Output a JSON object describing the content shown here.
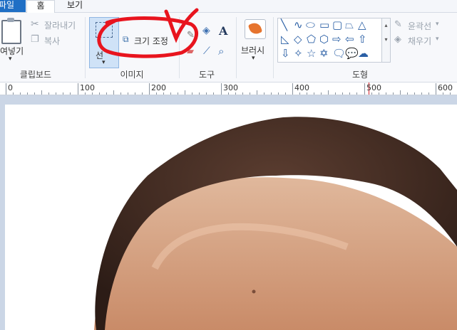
{
  "menu": {
    "file": "파일",
    "home": "홈",
    "view": "보기"
  },
  "clipboard": {
    "paste": "여넣기",
    "cut": "잘라내기",
    "copy": "복사",
    "label": "클립보드"
  },
  "image": {
    "select": "선",
    "resize": "크기 조정",
    "label": "이미지"
  },
  "tools": {
    "label": "도구"
  },
  "brushes": {
    "label": "브러시"
  },
  "shapes": {
    "outline": "윤곽선",
    "fill": "채우기",
    "label": "도형"
  },
  "ruler": {
    "ticks": [
      "0",
      "100",
      "200",
      "300",
      "400",
      "500",
      "600"
    ]
  },
  "colors": {
    "accent": "#1f6fc5",
    "annotation": "#e8141e",
    "ruler_marker": "#d6232c"
  },
  "icons": [
    "paste-icon",
    "scissors-icon",
    "copy-icon",
    "select-icon",
    "resize-icon",
    "fill-bucket-icon",
    "text-icon",
    "eraser-icon",
    "color-picker-icon",
    "magnifier-icon",
    "brush-icon",
    "outline-icon",
    "fill-icon"
  ]
}
